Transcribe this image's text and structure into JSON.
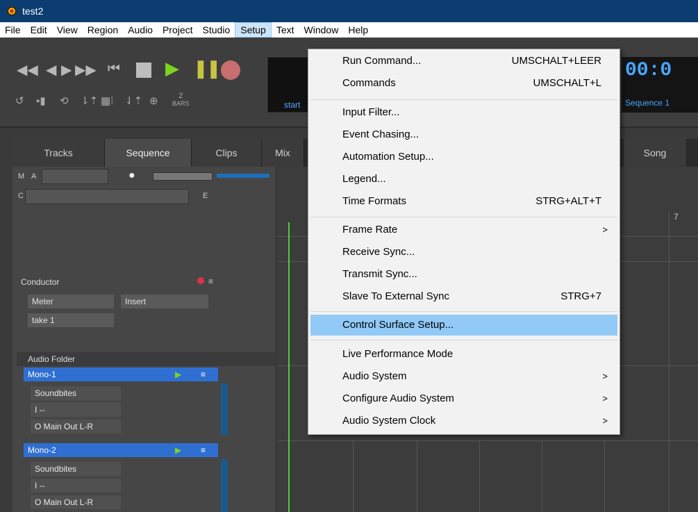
{
  "window": {
    "title": "test2"
  },
  "menubar": [
    "File",
    "Edit",
    "View",
    "Region",
    "Audio",
    "Project",
    "Studio",
    "Setup",
    "Text",
    "Window",
    "Help"
  ],
  "transport": {
    "start_label": "start",
    "bars_value": "2",
    "bars_label": "BARS",
    "time": "00:0",
    "sequence_selector": "Sequence 1"
  },
  "tabs": {
    "tracks": "Tracks",
    "sequence": "Sequence",
    "clips": "Clips",
    "mix": "Mix",
    "song": "Song"
  },
  "left_panel": {
    "m_label": "M",
    "a_label": "A",
    "c_label": "C",
    "e_label": "E",
    "conductor": "Conductor",
    "meter": "Meter",
    "insert": "Insert",
    "take": "take 1",
    "audio_folder": "Audio Folder"
  },
  "tracks": [
    {
      "name": "Mono-1",
      "input": "Soundbites",
      "mid": "I --",
      "output": "O Main Out L-R"
    },
    {
      "name": "Mono-2",
      "input": "Soundbites",
      "mid": "I --",
      "output": "O Main Out L-R"
    }
  ],
  "ruler": {
    "bar7": "7"
  },
  "setup_menu": [
    {
      "label": "Run Command...",
      "shortcut": "UMSCHALT+LEER"
    },
    {
      "label": "Commands",
      "shortcut": "UMSCHALT+L"
    },
    {
      "label": "Input Filter..."
    },
    {
      "label": "Event Chasing..."
    },
    {
      "label": "Automation Setup..."
    },
    {
      "label": "Legend..."
    },
    {
      "label": "Time Formats",
      "shortcut": "STRG+ALT+T"
    },
    {
      "label": "Frame Rate",
      "submenu": true
    },
    {
      "label": "Receive Sync..."
    },
    {
      "label": "Transmit Sync..."
    },
    {
      "label": "Slave To External Sync",
      "shortcut": "STRG+7"
    },
    {
      "label": "Control Surface Setup...",
      "highlighted": true
    },
    {
      "label": "Live Performance Mode"
    },
    {
      "label": "Audio System",
      "submenu": true
    },
    {
      "label": "Configure Audio System",
      "submenu": true
    },
    {
      "label": "Audio System Clock",
      "submenu": true
    }
  ]
}
